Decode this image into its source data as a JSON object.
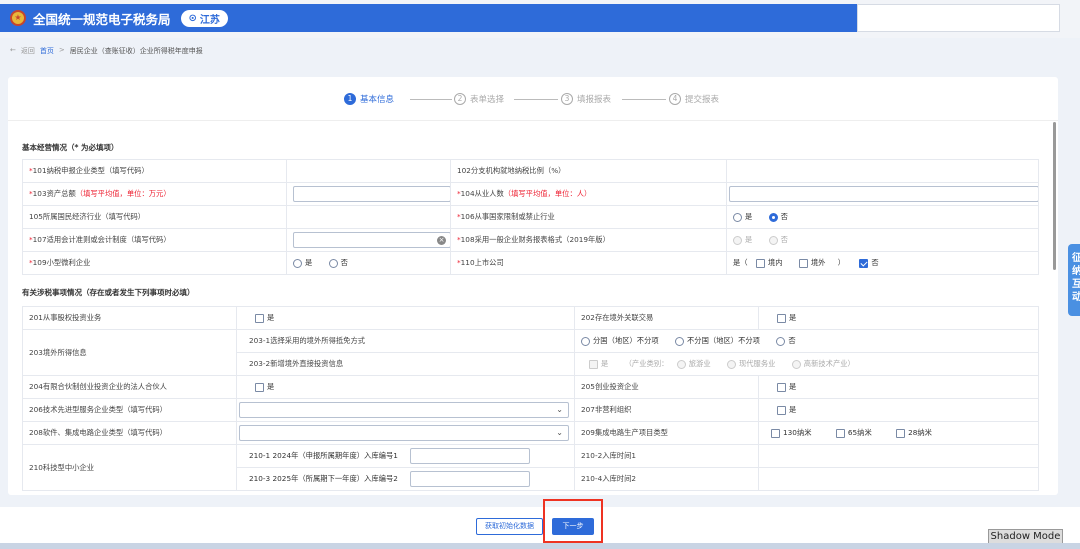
{
  "header": {
    "app_title": "全国统一规范电子税务局",
    "province": "江苏"
  },
  "breadcrumb": {
    "back": "返回",
    "home": "首页",
    "sep": ">",
    "current": "居民企业（查账征收）企业所得税年度申报"
  },
  "steps": [
    {
      "num": "1",
      "label": "基本信息"
    },
    {
      "num": "2",
      "label": "表单选择"
    },
    {
      "num": "3",
      "label": "填报报表"
    },
    {
      "num": "4",
      "label": "提交报表"
    }
  ],
  "section1": {
    "title": "基本经营情况（* 为必填项）",
    "r101": "101纳税申报企业类型（填写代码）",
    "r102": "102分支机构就地纳税比例（%）",
    "r103": "103资产总额",
    "r103_note": "（填写平均值，单位：万元）",
    "r104": "104从业人数",
    "r104_note": "（填写平均值，单位：人）",
    "r105": "105所属国民经济行业（填写代码）",
    "r106": "106从事国家限制或禁止行业",
    "r107": "107适用会计准则或会计制度（填写代码）",
    "r108": "108采用一般企业财务报表格式（2019年版）",
    "r109": "109小型微利企业",
    "r110": "110上市公司",
    "yes": "是",
    "no": "否",
    "domestic": "境内",
    "overseas": "境外",
    "yes_paren": "是（",
    "close_paren": "）"
  },
  "section2": {
    "title": "有关涉税事项情况（存在或者发生下列事项时必填）",
    "r201": "201从事股权投资业务",
    "r202": "202存在境外关联交易",
    "r203": "203境外所得信息",
    "r203_1": "203-1选择采用的境外所得抵免方式",
    "r203_2": "203-2新增境外直接投资信息",
    "opt_by_country": "分国（地区）不分项",
    "opt_not_by_country": "不分国（地区）不分项",
    "industry_label": "（产业类别：",
    "opt_tourism": "旅游业",
    "opt_modern": "现代服务业",
    "opt_hightech": "高新技术产业）",
    "r204": "204有限合伙制创业投资企业的法人合伙人",
    "r205": "205创业投资企业",
    "r206": "206技术先进型服务企业类型（填写代码）",
    "r207": "207非营利组织",
    "r208": "208软件、集成电路企业类型（填写代码）",
    "r209": "209集成电路生产项目类型",
    "opt_130": "130纳米",
    "opt_65": "65纳米",
    "opt_28": "28纳米",
    "r210": "210科技型中小企业",
    "r210_1": "210-1 2024年（申报所属期年度）入库编号1",
    "r210_2": "210-2入库时间1",
    "r210_3": "210-3 2025年（所属期下一年度）入库编号2",
    "r210_4": "210-4入库时间2"
  },
  "side_widget": "征纳互动",
  "footer": {
    "init_button": "获取初始化数据",
    "next_button": "下一步"
  },
  "shadow_mode": "Shadow Mode"
}
